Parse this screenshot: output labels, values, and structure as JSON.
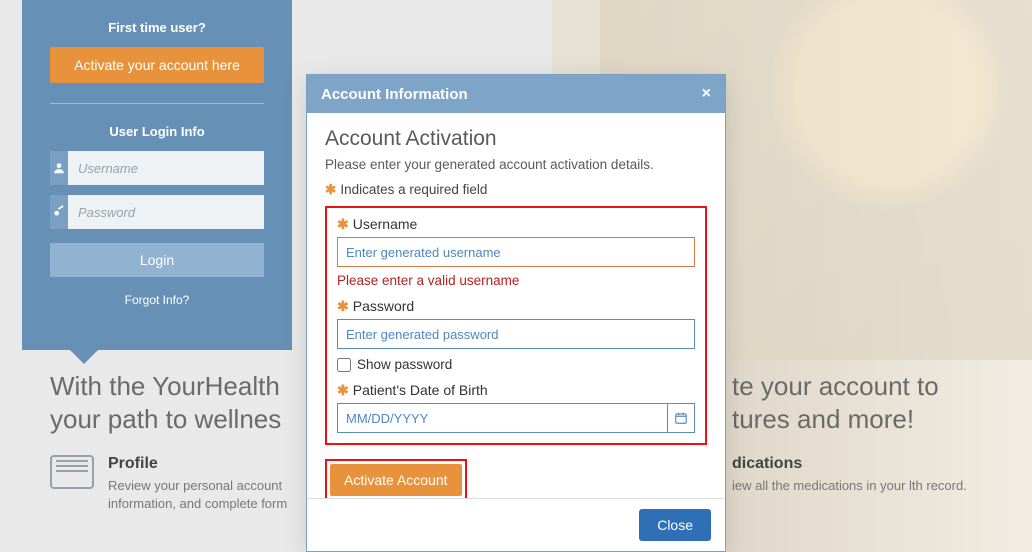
{
  "sidebar": {
    "first_time_heading": "First time user?",
    "activate_btn": "Activate your account here",
    "login_heading": "User Login Info",
    "username_placeholder": "Username",
    "password_placeholder": "Password",
    "login_btn": "Login",
    "forgot": "Forgot Info?"
  },
  "headline_left": "With the YourHealth\nyour path to wellnes",
  "headline_right": "te your account to\ntures and more!",
  "features": {
    "profile": {
      "title": "Profile",
      "desc": "Review your personal account information, and complete form"
    },
    "medications": {
      "title": "dications",
      "desc": "iew all the medications in your lth record."
    }
  },
  "modal": {
    "header": "Account Information",
    "title": "Account Activation",
    "subtitle": "Please enter your generated account activation details.",
    "required_note": "Indicates a required field",
    "username_label": "Username",
    "username_placeholder": "Enter generated username",
    "username_error": "Please enter a valid username",
    "password_label": "Password",
    "password_placeholder": "Enter generated password",
    "show_password_label": "Show password",
    "dob_label": "Patient's Date of Birth",
    "dob_placeholder": "MM/DD/YYYY",
    "activate_btn": "Activate Account",
    "close_btn": "Close"
  }
}
